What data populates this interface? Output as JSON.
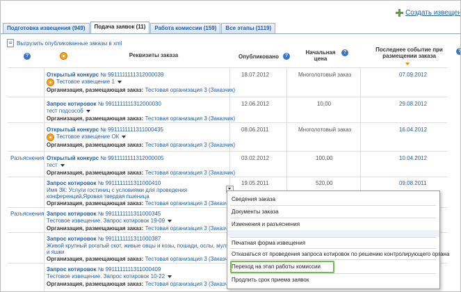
{
  "header": {
    "create_label": "Создать извещен"
  },
  "tabs": [
    {
      "label": "Подготовка извещения (949)"
    },
    {
      "label": "Подача заявок (11)"
    },
    {
      "label": "Работа комиссии (159)"
    },
    {
      "label": "Все этапы (1119)"
    }
  ],
  "export_label": "Выгрузить опубликованные заказы в xml",
  "columns": {
    "requisites": "Реквизиты заказа",
    "published": "Опубликовано",
    "price_line1": "Начальная",
    "price_line2": "цена",
    "event_line1": "Последнее событие при",
    "event_line2": "размещении заказа"
  },
  "org_label": "Организация, размещающая заказ:",
  "rows": [
    {
      "side": "",
      "type": "Открытый конкурс",
      "num": "№ 9911111111312000039",
      "name": "Тестовое извещение 1",
      "org": "Тестовая организация 3 (Заказчик)",
      "published": "18.07.2012",
      "price": "Многолотовый заказ",
      "event": "07.09.2012"
    },
    {
      "side": "",
      "type": "Запрос котировок",
      "num": "№ 9911111111312000030",
      "name": "тест подсособ",
      "org": "Тестовая организация 3 (Заказчик)",
      "published": "12.06.2012",
      "price": "10,00",
      "event": "29.08.2012"
    },
    {
      "side": "",
      "type": "Открытый конкурс",
      "num": "№ 9911111111311000435",
      "name": "Тестовое извещение ОК",
      "org": "Тестовая организация 3 (Заказчик)",
      "published": "08.06.2011",
      "price": "Многолотовый заказ",
      "event": "16.04.2012"
    },
    {
      "side": "Разъяснения",
      "type": "Открытый конкурс",
      "num": "№ 9911111111312000005",
      "name": "тест",
      "org": "Тестовая организация 3 (Заказчик)",
      "published": "03.02.2012",
      "price": "100,00",
      "event": "10.04.2012"
    },
    {
      "side": "",
      "type": "Запрос котировок",
      "num": "№ 9911111111311000410",
      "name": "Имя ЗК: Услуги гостиниц с условиями для проведения",
      "name2": "конференций,Яровая твердая пшеница",
      "org": "Тестовая организация 3 (Заказчик)",
      "published": "19.05.2011",
      "price": "520,00",
      "event": "09.08.2011"
    },
    {
      "side": "Разъяснения",
      "type": "Запрос котировок",
      "num": "№ 9911111111311000345",
      "name": "Тестовое извещение. Запрос котировок 19-09",
      "org": "Тестовая организация 3 (Заказчик)",
      "published": "",
      "price": "",
      "event": ""
    },
    {
      "side": "",
      "type": "Запрос котировок",
      "num": "№ 9911111111311000387",
      "name": "Живой крупный рогатый скот, живые овцы и козы, пошади, ослы, мулы",
      "name2": "и яшки",
      "org": "Тестовая организация 3 (Заказчик)",
      "published": "",
      "price": "",
      "event": ""
    },
    {
      "side": "",
      "type": "Запрос котировок",
      "num": "№ 9911111111311000409",
      "name": "Тестовое извещение. Запрос котировок 10-22",
      "org": "Тестовая организация 3 (Заказчик)",
      "published": "",
      "price": "",
      "event": ""
    }
  ],
  "menu": {
    "items": [
      "Сведения заказа",
      "Документы заказа",
      "Изменения и разъяснения",
      "Печатная форма извещения",
      "Отказаться от проведения запроса котировок по решению контролирующего органа",
      "Переход на этап работы комиссии",
      "Продлить срок приема заявок"
    ]
  }
}
